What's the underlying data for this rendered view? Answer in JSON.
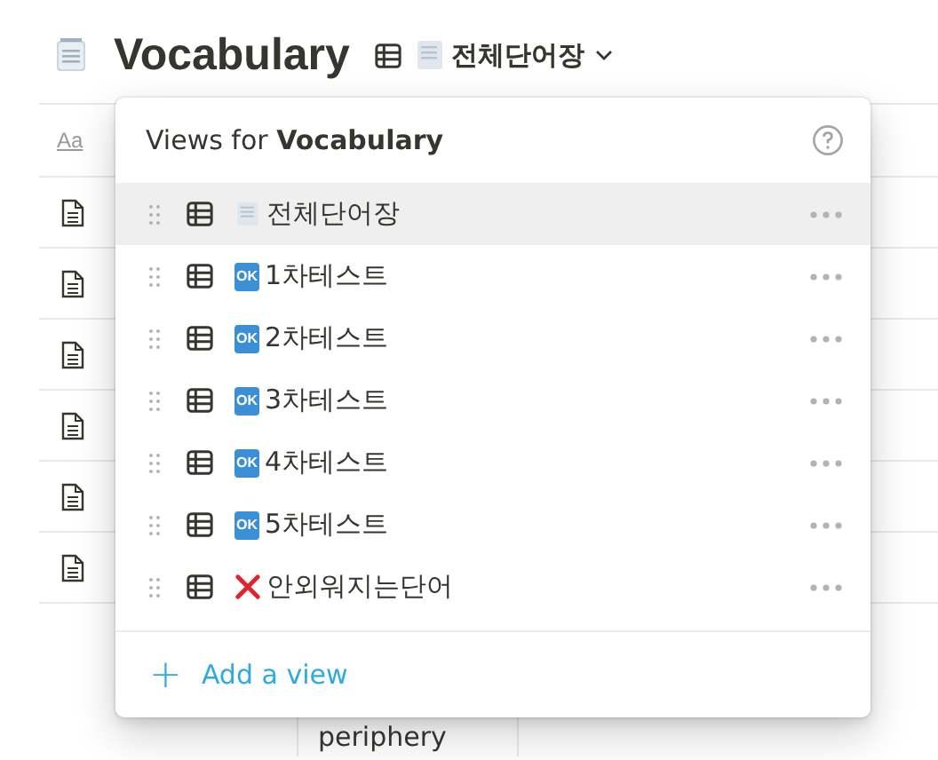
{
  "page": {
    "title": "Vocabulary",
    "current_view": {
      "kind": "document",
      "label": "전체단어장"
    }
  },
  "table": {
    "header_icon": "Aa",
    "bottom_row": {
      "cell": "periphery"
    }
  },
  "views_menu": {
    "title_prefix": "Views for ",
    "title_bold": "Vocabulary",
    "views": [
      {
        "kind": "document",
        "label": "전체단어장",
        "selected": true
      },
      {
        "kind": "ok",
        "badge": "OK",
        "label": "1차테스트",
        "selected": false
      },
      {
        "kind": "ok",
        "badge": "OK",
        "label": "2차테스트",
        "selected": false
      },
      {
        "kind": "ok",
        "badge": "OK",
        "label": "3차테스트",
        "selected": false
      },
      {
        "kind": "ok",
        "badge": "OK",
        "label": "4차테스트",
        "selected": false
      },
      {
        "kind": "ok",
        "badge": "OK",
        "label": "5차테스트",
        "selected": false
      },
      {
        "kind": "cross",
        "label": "안외워지는단어",
        "selected": false
      }
    ],
    "add_icon": "+",
    "add_label": "Add a view"
  }
}
